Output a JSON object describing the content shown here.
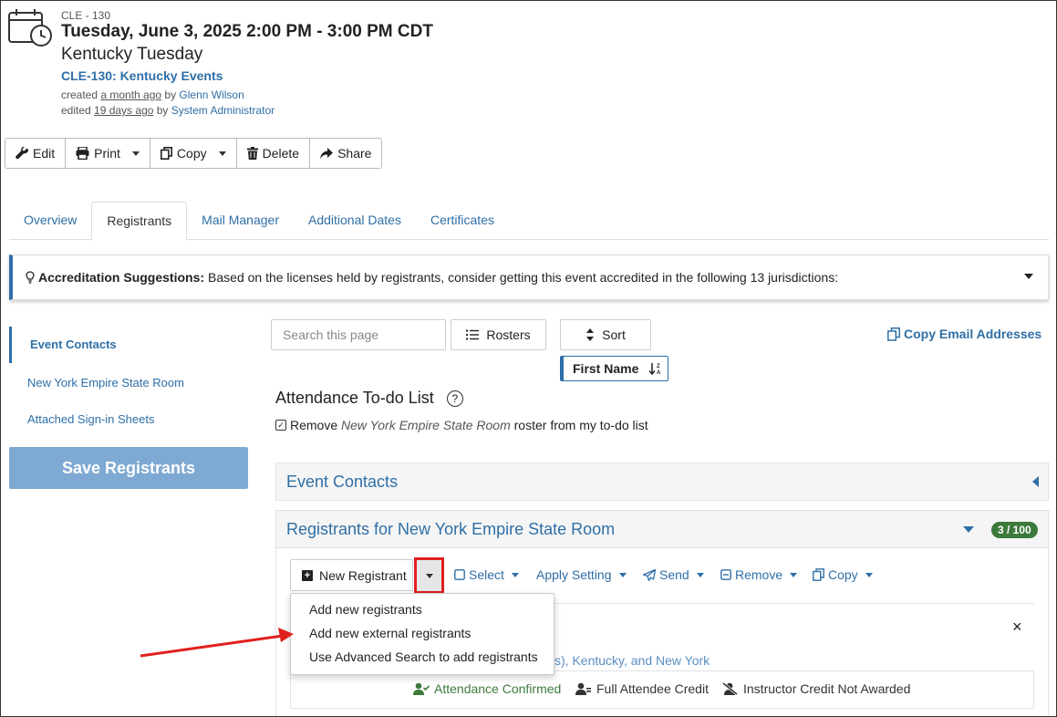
{
  "event": {
    "code": "CLE - 130",
    "datetime": "Tuesday, June 3, 2025 2:00 PM - 3:00 PM CDT",
    "title": "Kentucky Tuesday",
    "series_link": "CLE-130: Kentucky Events",
    "created_prefix": "created ",
    "created_when": "a month ago",
    "created_by_prefix": " by ",
    "created_by": "Glenn Wilson",
    "edited_prefix": "edited ",
    "edited_when": "19 days ago",
    "edited_by_prefix": " by ",
    "edited_by": "System Administrator"
  },
  "toolbar": {
    "edit": "Edit",
    "print": "Print",
    "copy": "Copy",
    "delete": "Delete",
    "share": "Share"
  },
  "tabs": [
    {
      "label": "Overview",
      "active": false
    },
    {
      "label": "Registrants",
      "active": true
    },
    {
      "label": "Mail Manager",
      "active": false
    },
    {
      "label": "Additional Dates",
      "active": false
    },
    {
      "label": "Certificates",
      "active": false
    }
  ],
  "alert": {
    "bold": "Accreditation Suggestions:",
    "text": "Based on the licenses held by registrants, consider getting this event accredited in the following 13 jurisdictions:"
  },
  "sidebar": {
    "items": [
      {
        "label": "Event Contacts",
        "active": true
      },
      {
        "label": "New York Empire State Room",
        "active": false
      },
      {
        "label": "Attached Sign-in Sheets",
        "active": false
      }
    ],
    "save_label": "Save Registrants"
  },
  "controls": {
    "search_placeholder": "Search this page",
    "rosters": "Rosters",
    "sort": "Sort",
    "sort_field": "First Name",
    "copy_email": "Copy Email Addresses"
  },
  "todo": {
    "title": "Attendance To-do List",
    "help": "?",
    "remove_prefix": "Remove ",
    "roster_name": "New York Empire State Room",
    "remove_suffix": " roster from my to-do list"
  },
  "panels": {
    "event_contacts": "Event Contacts",
    "registrants_title": "Registrants for New York Empire State Room",
    "count": "3 / 100"
  },
  "actions": {
    "new_registrant": "New Registrant",
    "select": "Select",
    "apply_setting": "Apply Setting",
    "send": "Send",
    "remove": "Remove",
    "copy": "Copy"
  },
  "dropdown": {
    "items": [
      "Add new registrants",
      "Add new external registrants",
      "Use Advanced Search to add registrants"
    ]
  },
  "registrant_detail": {
    "close": "×",
    "jurisdictions_partial": "s), Kentucky, and New York",
    "status_attendance": "Attendance Confirmed",
    "status_credit": "Full Attendee Credit",
    "status_instructor": "Instructor Credit Not Awarded"
  },
  "colors": {
    "link": "#2f6fa7",
    "save_button": "#7ea9d2",
    "badge": "#3c7a3c",
    "highlight": "#e0201f"
  }
}
